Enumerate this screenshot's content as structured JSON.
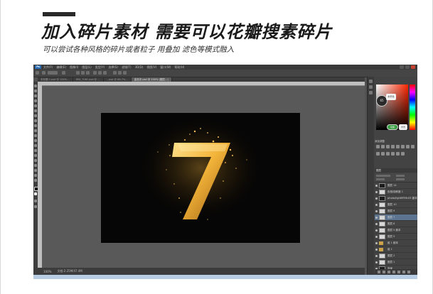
{
  "heading": {
    "title": "加入碎片素材 需要可以花瓣搜素碎片",
    "subtitle": "可以尝试各种风格的碎片或者粒子 用叠加 滤色等模式融入"
  },
  "photoshop": {
    "logo": "Ps",
    "menu": [
      "文件(F)",
      "编辑(E)",
      "图像(I)",
      "图层(L)",
      "类型(Y)",
      "选择(S)",
      "滤镜(T)",
      "3D(D)",
      "视图(V)",
      "窗口(W)",
      "帮助(H)"
    ],
    "tabs": [
      {
        "label": "未标题-1.psd @ 100%…",
        "active": false
      },
      {
        "label": "IMG_7061.psd @ …",
        "active": false
      },
      {
        "label": "…psd @ 66.7%…",
        "active": false
      },
      {
        "label": "金色字.psd @ 100% (图层…)",
        "active": true
      }
    ],
    "status": {
      "zoom": "100%",
      "doc": "文档:2.25M/47.4M"
    },
    "color_picker": {
      "badge": "65",
      "tip": "前景色",
      "toggle": "切换",
      "tip2": "背景"
    },
    "adjustments_title": "添加调整",
    "layers_title": "图层",
    "layers": [
      {
        "name": "图层 14",
        "thumb": "dark",
        "selected": false
      },
      {
        "name": "色相/饱和度 1",
        "thumb": "light",
        "selected": false
      },
      {
        "name": "photo/lightMYMc05 副本",
        "thumb": "dark",
        "selected": false
      },
      {
        "name": "图层 10",
        "thumb": "light",
        "selected": false
      },
      {
        "name": "图层 9",
        "thumb": "light",
        "selected": false
      },
      {
        "name": "图层 7",
        "thumb": "light",
        "selected": true
      },
      {
        "name": "图层 6",
        "thumb": "light",
        "selected": false
      },
      {
        "name": "图层 5 副本",
        "thumb": "light",
        "selected": false
      },
      {
        "name": "图层 5",
        "thumb": "light",
        "selected": false
      },
      {
        "name": "组 1 副本",
        "thumb": "folder",
        "selected": false
      },
      {
        "name": "组 1",
        "thumb": "folder",
        "selected": false
      },
      {
        "name": "图层 2",
        "thumb": "light",
        "selected": false
      },
      {
        "name": "图层 1",
        "thumb": "light",
        "selected": false
      },
      {
        "name": "背景",
        "thumb": "dark",
        "selected": false
      }
    ],
    "artwork": {
      "glyph": "7"
    },
    "colors": {
      "accent_gold": "#f3b43a",
      "selection": "#5d7490",
      "ps_blue": "#2b6eb5"
    }
  }
}
